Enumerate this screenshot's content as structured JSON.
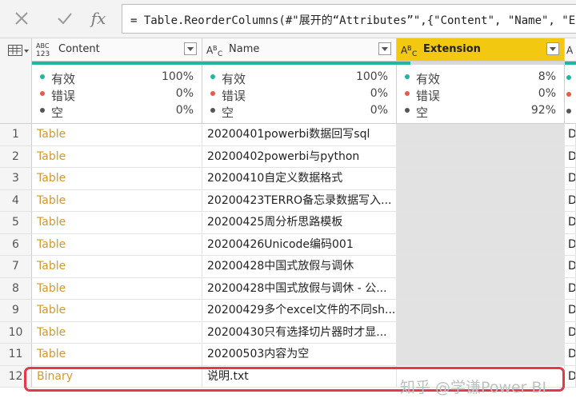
{
  "formula_bar": {
    "cancel_icon": "x-icon",
    "commit_icon": "checkmark-icon",
    "fx_label": "fx",
    "formula": "= Table.ReorderColumns(#\"展开的“Attributes”\",{\"Content\", \"Name\", \"Extension\""
  },
  "columns": [
    {
      "name": "Content",
      "type_icon": "ABC123",
      "selected": false
    },
    {
      "name": "Name",
      "type_icon": "ABC",
      "selected": false
    },
    {
      "name": "Extension",
      "type_icon": "ABC",
      "selected": true
    },
    {
      "name": "",
      "type_icon": "A",
      "selected": false
    }
  ],
  "stats_labels": {
    "valid": "有效",
    "error": "错误",
    "empty": "空"
  },
  "status_colors": {
    "valid": "#1fb6a4",
    "error": "#e85b4a",
    "empty": "#555555"
  },
  "column_stats": [
    {
      "valid": "100%",
      "error": "0%",
      "empty": "0%"
    },
    {
      "valid": "100%",
      "error": "0%",
      "empty": "0%"
    },
    {
      "valid": "8%",
      "error": "0%",
      "empty": "92%"
    }
  ],
  "rows": [
    {
      "n": "1",
      "content": "Table",
      "name": "20200401powerbi数据回写sql",
      "extension": "",
      "last": "D"
    },
    {
      "n": "2",
      "content": "Table",
      "name": "20200402powerbi与python",
      "extension": "",
      "last": "D"
    },
    {
      "n": "3",
      "content": "Table",
      "name": "20200410自定义数据格式",
      "extension": "",
      "last": "D"
    },
    {
      "n": "4",
      "content": "Table",
      "name": "20200423TERRO备忘录数据写入...",
      "extension": "",
      "last": "D"
    },
    {
      "n": "5",
      "content": "Table",
      "name": "20200425周分析思路模板",
      "extension": "",
      "last": "D"
    },
    {
      "n": "6",
      "content": "Table",
      "name": "20200426Unicode编码001",
      "extension": "",
      "last": "D"
    },
    {
      "n": "7",
      "content": "Table",
      "name": "20200428中国式放假与调休",
      "extension": "",
      "last": "D"
    },
    {
      "n": "8",
      "content": "Table",
      "name": "20200428中国式放假与调休 - 公...",
      "extension": "",
      "last": "D"
    },
    {
      "n": "9",
      "content": "Table",
      "name": "20200429多个excel文件的不同sh...",
      "extension": "",
      "last": "D"
    },
    {
      "n": "10",
      "content": "Table",
      "name": "20200430只有选择切片器时才显...",
      "extension": "",
      "last": "D"
    },
    {
      "n": "11",
      "content": "Table",
      "name": "20200503内容为空",
      "extension": "",
      "last": "D"
    },
    {
      "n": "12",
      "content": "Binary",
      "name": "说明.txt",
      "extension": "",
      "last": "D"
    }
  ],
  "highlight_color": "#e53946",
  "watermark": "知乎 @学谦Power BI"
}
